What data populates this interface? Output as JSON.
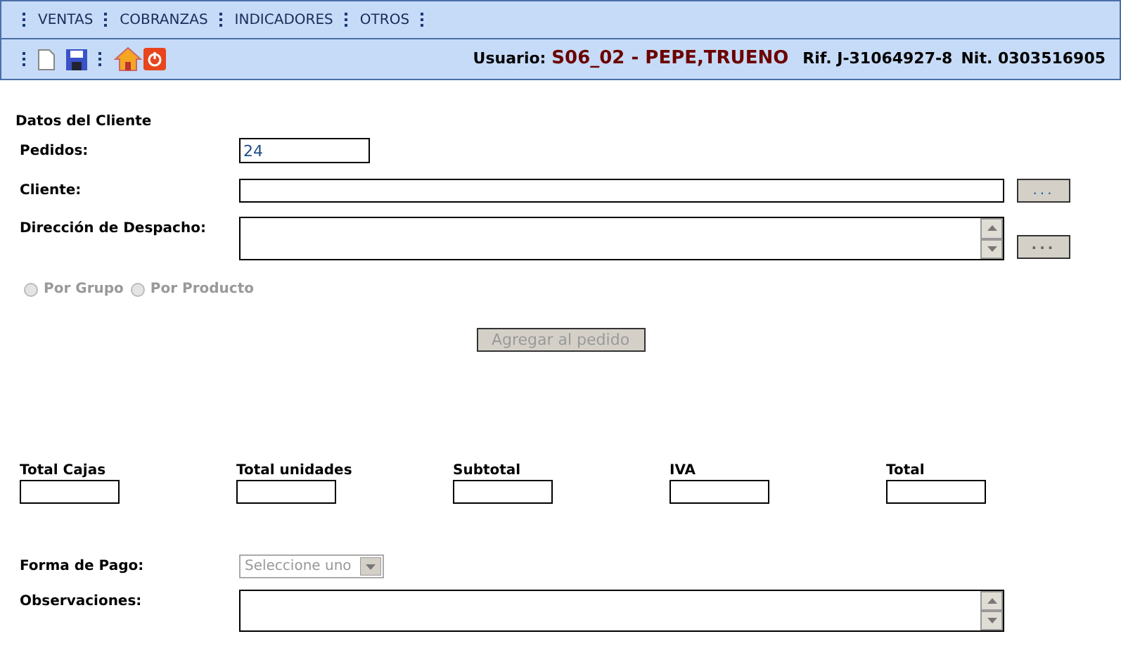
{
  "menu": [
    "VENTAS",
    "COBRANZAS",
    "INDICADORES",
    "OTROS"
  ],
  "user_info": {
    "usuario_label": "Usuario:",
    "usuario": "S06_02 - PEPE,TRUENO",
    "rif": "Rif. J-31064927-8",
    "nit": "Nit. 0303516905"
  },
  "section_title": "Datos del Cliente",
  "pedidos": {
    "label": "Pedidos:",
    "value": "24"
  },
  "cliente": {
    "label": "Cliente:",
    "button": "...",
    "button_disabled": false
  },
  "direccion": {
    "label": "Dirección de Despacho:",
    "button": "...",
    "button_disabled": true
  },
  "radios": [
    {
      "label": "Por Grupo",
      "selected": false,
      "disabled": true
    },
    {
      "label": "Por Producto",
      "selected": false,
      "disabled": true
    }
  ],
  "add_button": {
    "label": "Agregar al pedido",
    "disabled": true
  },
  "totals": [
    {
      "label": "Total Cajas"
    },
    {
      "label": "Total unidades"
    },
    {
      "label": "Subtotal"
    },
    {
      "label": "IVA"
    },
    {
      "label": "Total"
    }
  ],
  "forma_pago": {
    "label": "Forma de Pago:",
    "placeholder": "Seleccione uno",
    "disabled": true
  },
  "observaciones": {
    "label": "Observaciones:"
  }
}
